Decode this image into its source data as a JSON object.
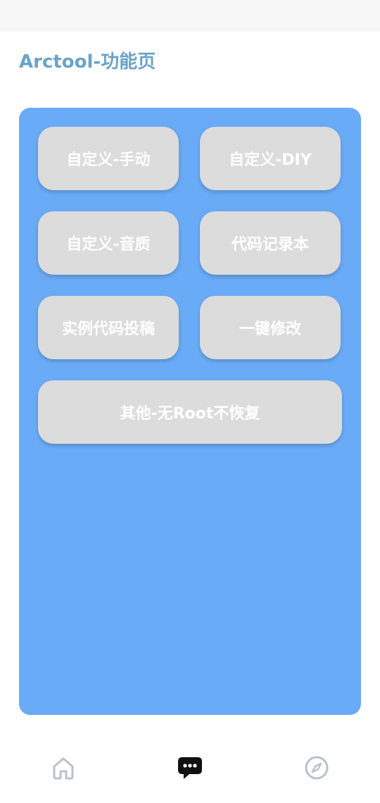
{
  "header": {
    "title": "Arctool-功能页"
  },
  "buttons": {
    "manual": "自定义-手动",
    "diy": "自定义-DIY",
    "audio": "自定义-音质",
    "code_notebook": "代码记录本",
    "submit_example": "实例代码投稿",
    "one_click": "一键修改",
    "other_no_root": "其他-无Root不恢复"
  },
  "colors": {
    "title": "#6aa3c9",
    "panel": "#6aabf7",
    "button": "#dcdcdc",
    "button_text": "#ffffff",
    "nav_inactive": "#b8c2cc",
    "nav_active": "#111111"
  },
  "bottom_nav": {
    "items": [
      {
        "icon": "home-icon",
        "active": false
      },
      {
        "icon": "chat-bubble-icon",
        "active": true
      },
      {
        "icon": "compass-icon",
        "active": false
      }
    ]
  }
}
